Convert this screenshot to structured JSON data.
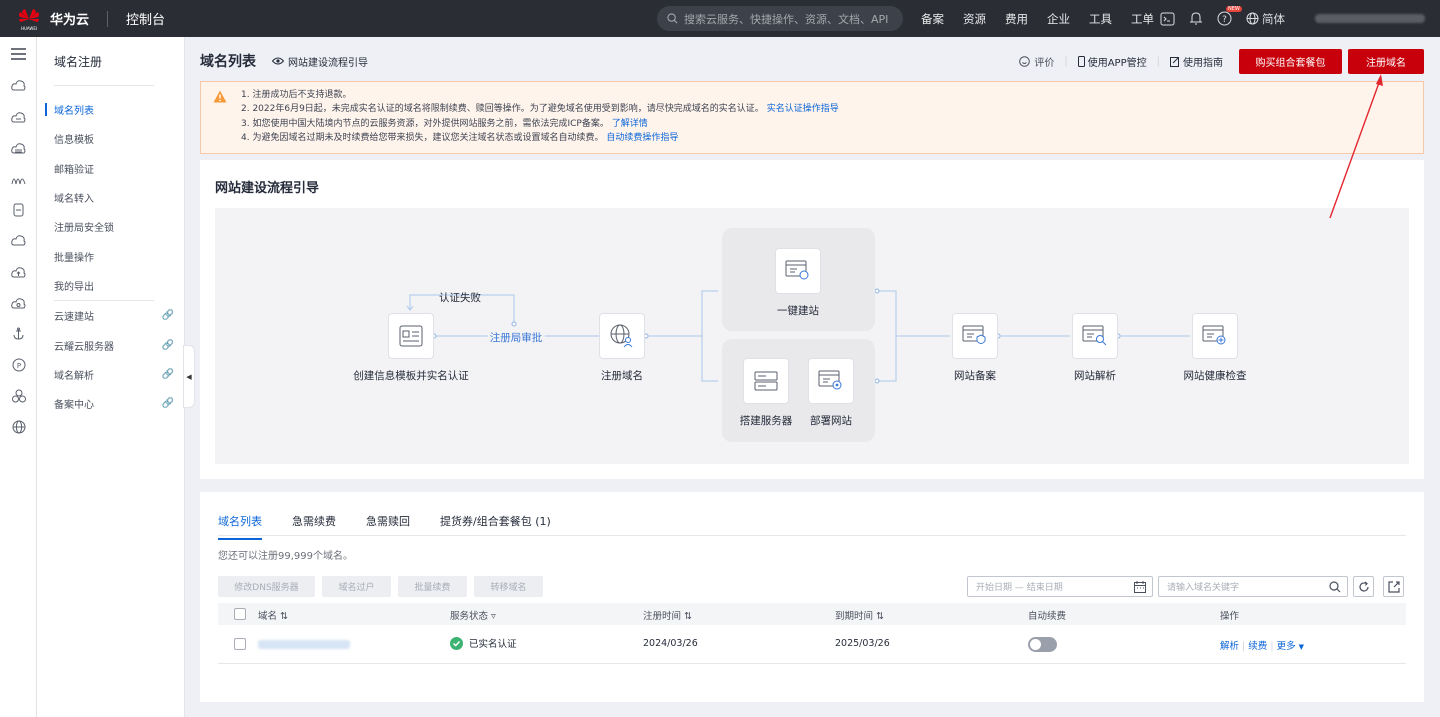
{
  "topbar": {
    "brand": "华为云",
    "brand_sub": "HUAWEI",
    "console": "控制台",
    "search_placeholder": "搜索云服务、快捷操作、资源、文档、API",
    "nav": [
      "备案",
      "资源",
      "费用",
      "企业",
      "工具",
      "工单"
    ],
    "new_badge": "NEW",
    "lang": "简体"
  },
  "menu": {
    "title": "域名注册",
    "items": [
      {
        "label": "域名列表",
        "active": true,
        "external": false
      },
      {
        "label": "信息模板",
        "active": false,
        "external": false
      },
      {
        "label": "邮箱验证",
        "active": false,
        "external": false
      },
      {
        "label": "域名转入",
        "active": false,
        "external": false
      },
      {
        "label": "注册局安全锁",
        "active": false,
        "external": false
      },
      {
        "label": "批量操作",
        "active": false,
        "external": false
      },
      {
        "label": "我的导出",
        "active": false,
        "external": false
      }
    ],
    "links": [
      {
        "label": "云速建站",
        "external": true
      },
      {
        "label": "云耀云服务器",
        "external": true
      },
      {
        "label": "域名解析",
        "external": true
      },
      {
        "label": "备案中心",
        "external": true
      }
    ]
  },
  "page": {
    "title": "域名列表",
    "guide_link": "网站建设流程引导",
    "rate": "评价",
    "app": "使用APP管控",
    "manual": "使用指南",
    "buy_button": "购买组合套餐包",
    "register_button": "注册域名"
  },
  "notice": {
    "l1": "1. 注册成功后不支持退款。",
    "l2": "2. 2022年6月9日起，未完成实名认证的域名将限制续费、赎回等操作。为了避免域名使用受到影响，请尽快完成域名的实名认证。",
    "l2_link": "实名认证操作指导",
    "l3": "3. 如您使用中国大陆境内节点的云服务资源，对外提供网站服务之前，需依法完成ICP备案。",
    "l3_link": "了解详情",
    "l4": "4. 为避免因域名过期未及时续费给您带来损失，建议您关注域名状态或设置域名自动续费。",
    "l4_link": "自动续费操作指导"
  },
  "flow": {
    "title": "网站建设流程引导",
    "auth_fail": "认证失败",
    "registry_review": "注册局审批",
    "step_template": "创建信息模板并实名认证",
    "step_register": "注册域名",
    "step_onekey": "一键建站",
    "step_server": "搭建服务器",
    "step_deploy": "部署网站",
    "step_icp": "网站备案",
    "step_dns": "网站解析",
    "step_health": "网站健康检查"
  },
  "list": {
    "tabs": [
      "域名列表",
      "急需续费",
      "急需赎回",
      "提货券/组合套餐包 (1)"
    ],
    "hint": "您还可以注册99,999个域名。",
    "actions": [
      "修改DNS服务器",
      "域名过户",
      "批量续费",
      "转移域名"
    ],
    "date_placeholder": "开始日期 — 结束日期",
    "keyword_placeholder": "请输入域名关键字",
    "columns": [
      "域名",
      "服务状态",
      "注册时间",
      "到期时间",
      "自动续费",
      "操作"
    ],
    "rows": [
      {
        "status": "已实名认证",
        "registered": "2024/03/26",
        "expires": "2025/03/26",
        "auto_renew": false,
        "ops": [
          "解析",
          "续费",
          "更多"
        ]
      }
    ]
  },
  "colors": {
    "brand_red": "#c7000b",
    "link_blue": "#0c66d8",
    "topbar_bg": "#2a2d34",
    "success_green": "#3cb371"
  }
}
